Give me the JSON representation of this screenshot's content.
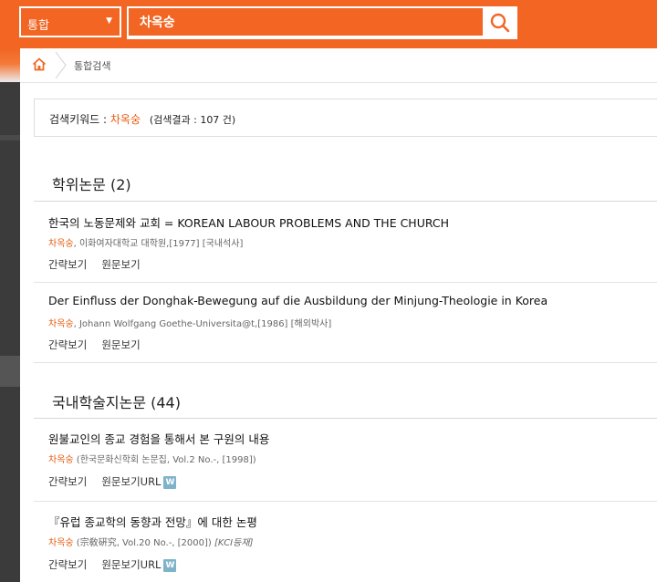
{
  "search": {
    "scope": "통합",
    "query": "차옥숭"
  },
  "breadcrumb": {
    "current": "통합검색"
  },
  "summary": {
    "label": "검색키워드 :",
    "keyword": "차옥숭",
    "result_text": "(검색결과 : 107 건)"
  },
  "sections": [
    {
      "title": "학위논문 (2)",
      "items": [
        {
          "title": "한국의 노동문제와 교회 = KOREAN LABOUR PROBLEMS AND THE CHURCH",
          "author": "차옥숭",
          "meta": ", 이화여자대학교 대학원,[1977] [국내석사]",
          "links": [
            "간략보기",
            "원문보기"
          ]
        },
        {
          "title": "Der Einfluss der Donghak-Bewegung auf die Ausbildung der Minjung-Theologie in Korea",
          "author": "차옥숭",
          "meta": ", Johann Wolfgang Goethe-Universita@t,[1986] [해외박사]",
          "links": [
            "간략보기",
            "원문보기"
          ]
        }
      ]
    },
    {
      "title": "국내학술지논문 (44)",
      "items": [
        {
          "title": "원불교인의 종교 경험을 통해서 본 구원의 내용",
          "author": "차옥숭",
          "meta": " (한국문화신학회 논문집, Vol.2 No.-, [1998])",
          "links": [
            "간략보기",
            "원문보기URL"
          ],
          "badge": "W"
        },
        {
          "title": "『유럽 종교학의 동향과 전망』에 대한 논평",
          "author": "차옥숭",
          "meta": " (宗敎硏究, Vol.20 No.-, [2000])",
          "kci": "[KCI등재]",
          "links": [
            "간략보기",
            "원문보기URL"
          ],
          "badge": "W"
        }
      ]
    }
  ],
  "icons": {
    "search": "search-icon",
    "home": "home-icon",
    "caret": "caret-down-icon"
  },
  "colors": {
    "accent": "#f26522",
    "highlight": "#e8590c",
    "badge": "#7fb3c9"
  }
}
